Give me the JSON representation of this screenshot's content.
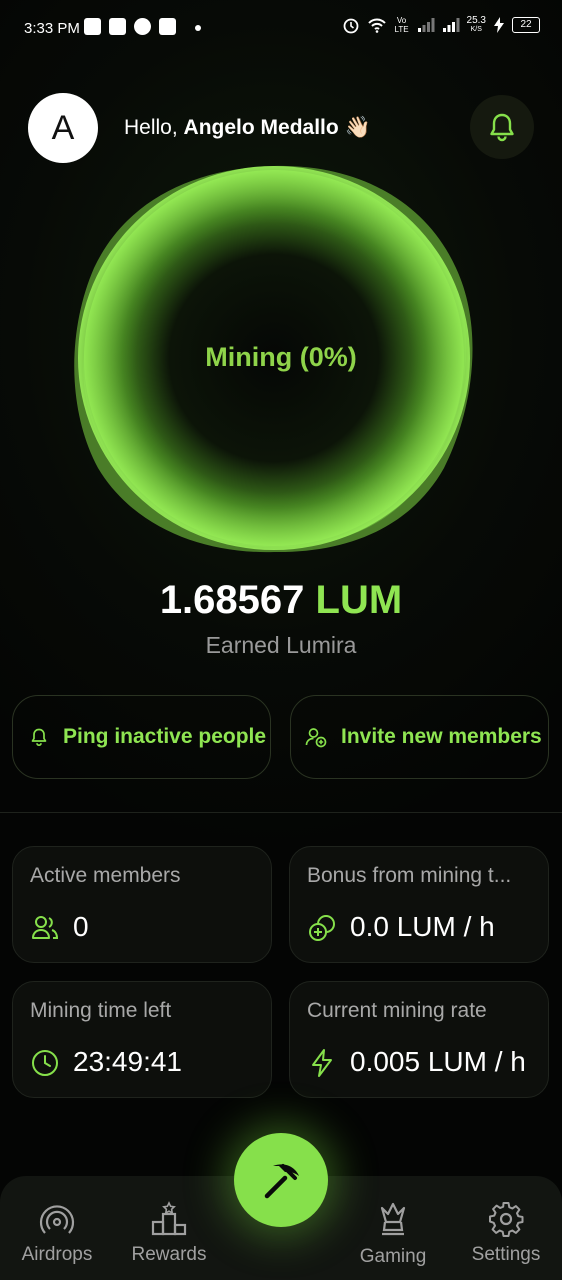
{
  "status_bar": {
    "time": "3:33 PM",
    "network_speed": "25.3",
    "network_unit": "K/S",
    "network_type": "Vo LTE",
    "battery": "22"
  },
  "header": {
    "avatar_letter": "A",
    "greeting_prefix": "Hello, ",
    "user_name": "Angelo Medallo",
    "greeting_emoji": "👋🏻",
    "notification_icon": "bell-icon"
  },
  "mining": {
    "status_label": "Mining (0%)",
    "progress": 0,
    "earned_amount": "1.68567",
    "earned_unit": "LUM",
    "earned_label": "Earned Lumira"
  },
  "actions": {
    "ping_label": "Ping inactive people",
    "invite_label": "Invite new members"
  },
  "stats": [
    {
      "title": "Active members",
      "value": "0",
      "icon": "users-icon"
    },
    {
      "title": "Bonus from mining t...",
      "value": "0.0 LUM / h",
      "icon": "coins-icon"
    },
    {
      "title": "Mining time left",
      "value": "23:49:41",
      "icon": "clock-icon"
    },
    {
      "title": "Current mining rate",
      "value": "0.005 LUM / h",
      "icon": "lightning-icon"
    }
  ],
  "nav": {
    "items": [
      {
        "label": "Airdrops",
        "icon": "airdrop-icon"
      },
      {
        "label": "Rewards",
        "icon": "podium-icon"
      },
      {
        "label": "Gaming",
        "icon": "chess-queen-icon"
      },
      {
        "label": "Settings",
        "icon": "gear-icon"
      }
    ],
    "center_icon": "pickaxe-icon"
  },
  "colors": {
    "accent": "#86e04b",
    "background": "#050705",
    "card": "#0d0f0c"
  }
}
